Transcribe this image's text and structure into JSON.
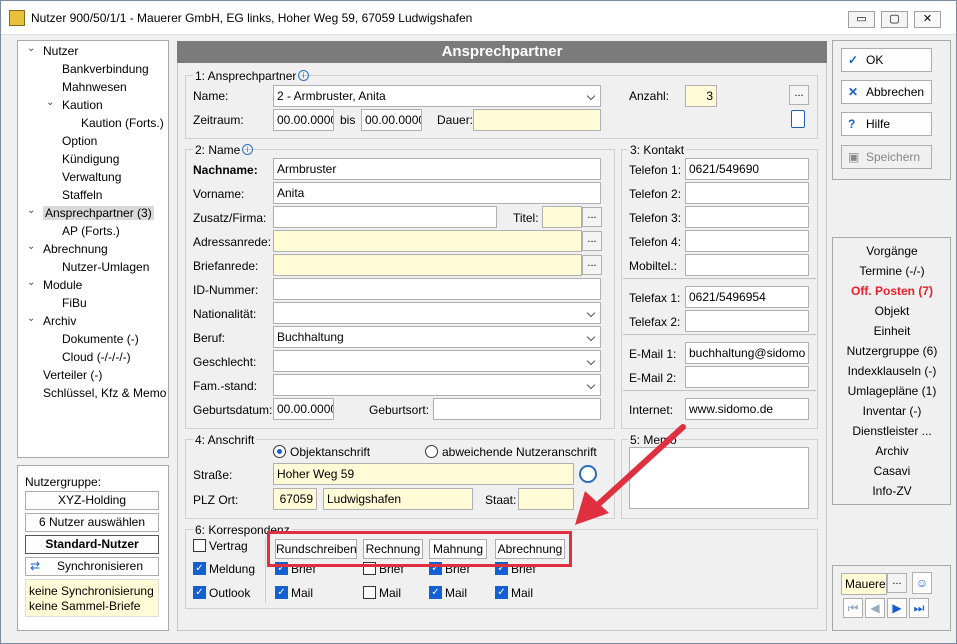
{
  "window": {
    "title": "Nutzer 900/50/1/1 - Mauerer GmbH, EG links, Hoher Weg 59, 67059 Ludwigshafen",
    "minimize": "▭",
    "maximize": "▢",
    "close": "✕"
  },
  "tree": [
    "Nutzer",
    "Bankverbindung",
    "Mahnwesen",
    "Kaution",
    "Kaution (Forts.)",
    "Option",
    "Kündigung",
    "Verwaltung",
    "Staffeln",
    "Ansprechpartner (3)",
    "AP (Forts.)",
    "Abrechnung",
    "Nutzer-Umlagen",
    "Module",
    "FiBu",
    "Archiv",
    "Dokumente (-)",
    "Cloud (-/-/-/-)",
    "Verteiler (-)",
    "Schlüssel, Kfz & Memo"
  ],
  "group_panel": {
    "label": "Nutzergruppe:",
    "holding": "XYZ-Holding",
    "select6": "6 Nutzer auswählen",
    "standard": "Standard-Nutzer",
    "sync": "Synchronisieren",
    "note1": "keine Synchronisierung",
    "note2": "keine Sammel-Briefe"
  },
  "header": "Ansprechpartner",
  "sec1": {
    "title": "1: Ansprechpartner",
    "name_label": "Name:",
    "name_value": "2 - Armbruster, Anita",
    "anzahl_label": "Anzahl:",
    "anzahl_value": "3",
    "zeitraum_label": "Zeitraum:",
    "from": "00.00.0000",
    "bis": "bis",
    "to": "00.00.0000",
    "dauer_label": "Dauer:",
    "dots": "..."
  },
  "sec2": {
    "title": "2: Name",
    "nachname_label": "Nachname:",
    "nachname": "Armbruster",
    "vorname_label": "Vorname:",
    "vorname": "Anita",
    "zusatz_label": "Zusatz/Firma:",
    "titel_label": "Titel:",
    "adressanrede_label": "Adressanrede:",
    "briefanrede_label": "Briefanrede:",
    "id_label": "ID-Nummer:",
    "nat_label": "Nationalität:",
    "beruf_label": "Beruf:",
    "beruf": "Buchhaltung",
    "geschlecht_label": "Geschlecht:",
    "famstand_label": "Fam.-stand:",
    "geburtsdatum_label": "Geburtsdatum:",
    "geburtsdatum": "00.00.0000",
    "geburtsort_label": "Geburtsort:"
  },
  "sec3": {
    "title": "3: Kontakt",
    "tel1_label": "Telefon 1:",
    "tel1": "0621/549690",
    "tel2_label": "Telefon 2:",
    "tel3_label": "Telefon 3:",
    "tel4_label": "Telefon 4:",
    "mobil_label": "Mobiltel.:",
    "fax1_label": "Telefax 1:",
    "fax1": "0621/5496954",
    "fax2_label": "Telefax 2:",
    "mail1_label": "E-Mail 1:",
    "mail1": "buchhaltung@sidomo",
    "mail2_label": "E-Mail 2:",
    "internet_label": "Internet:",
    "internet": "www.sidomo.de"
  },
  "sec4": {
    "title": "4: Anschrift",
    "radio1": "Objektanschrift",
    "radio2": "abweichende Nutzeranschrift",
    "strasse_label": "Straße:",
    "strasse": "Hoher Weg 59",
    "plz_label": "PLZ Ort:",
    "plz": "67059",
    "ort": "Ludwigshafen",
    "staat_label": "Staat:"
  },
  "sec5": {
    "title": "5: Memo"
  },
  "sec6": {
    "title": "6: Korrespondenz",
    "vertrag": "Vertrag",
    "meldung": "Meldung",
    "outlook": "Outlook",
    "btns": [
      "Rundschreiben",
      "Rechnung",
      "Mahnung",
      "Abrechnung"
    ],
    "brief": "Brief",
    "mail": "Mail"
  },
  "actions": {
    "ok": "OK",
    "abbrechen": "Abbrechen",
    "hilfe": "Hilfe",
    "speichern": "Speichern"
  },
  "links": [
    "Vorgänge",
    "Termine (-/-)",
    "Off. Posten (7)",
    "Objekt",
    "Einheit",
    "Nutzergruppe (6)",
    "Indexklauseln (-)",
    "Umlagepläne (1)",
    "Inventar (-)",
    "Dienstleister ...",
    "Archiv",
    "Casavi",
    "Info-ZV"
  ],
  "nav": {
    "user": "Mauere",
    "dots": "..."
  },
  "colors": {
    "alert": "#e8202a",
    "highlight_box": "#e03040"
  }
}
